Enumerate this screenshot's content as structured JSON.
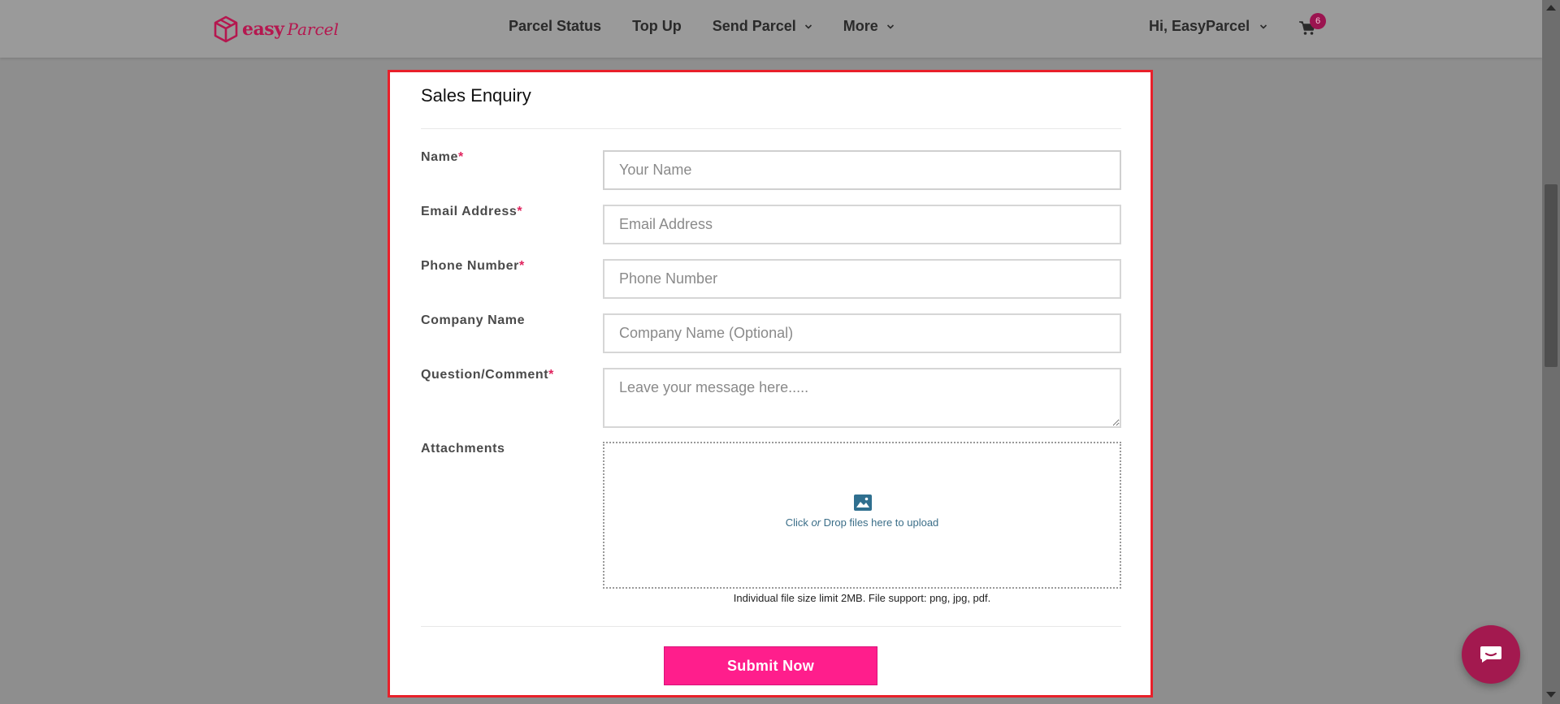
{
  "brand": {
    "name_bold": "easy",
    "name_script": "Parcel",
    "accent": "#b5174f"
  },
  "nav": {
    "items": [
      {
        "label": "Parcel Status",
        "dropdown": false
      },
      {
        "label": "Top Up",
        "dropdown": false
      },
      {
        "label": "Send Parcel",
        "dropdown": true
      },
      {
        "label": "More",
        "dropdown": true
      }
    ],
    "user_label": "Hi, EasyParcel",
    "cart_count": "6"
  },
  "form": {
    "title": "Sales Enquiry",
    "fields": {
      "name": {
        "label": "Name",
        "required": "*",
        "placeholder": "Your Name"
      },
      "email": {
        "label": "Email Address",
        "required": "*",
        "placeholder": "Email Address"
      },
      "phone": {
        "label": "Phone Number",
        "required": "*",
        "placeholder": "Phone Number"
      },
      "company": {
        "label": "Company Name",
        "placeholder": "Company Name (Optional)"
      },
      "comment": {
        "label": "Question/Comment",
        "required": "*",
        "placeholder": "Leave your message here....."
      }
    },
    "attachments": {
      "label": "Attachments",
      "dropzone_pre": "Click ",
      "dropzone_or": "or",
      "dropzone_post": " Drop files here to upload",
      "note": "Individual file size limit 2MB. File support: png, jpg, pdf."
    },
    "submit_label": "Submit Now"
  },
  "colors": {
    "submit_bg": "#ff1e8c",
    "highlight_border": "#e8202a",
    "chat_bg": "#a3194f"
  }
}
